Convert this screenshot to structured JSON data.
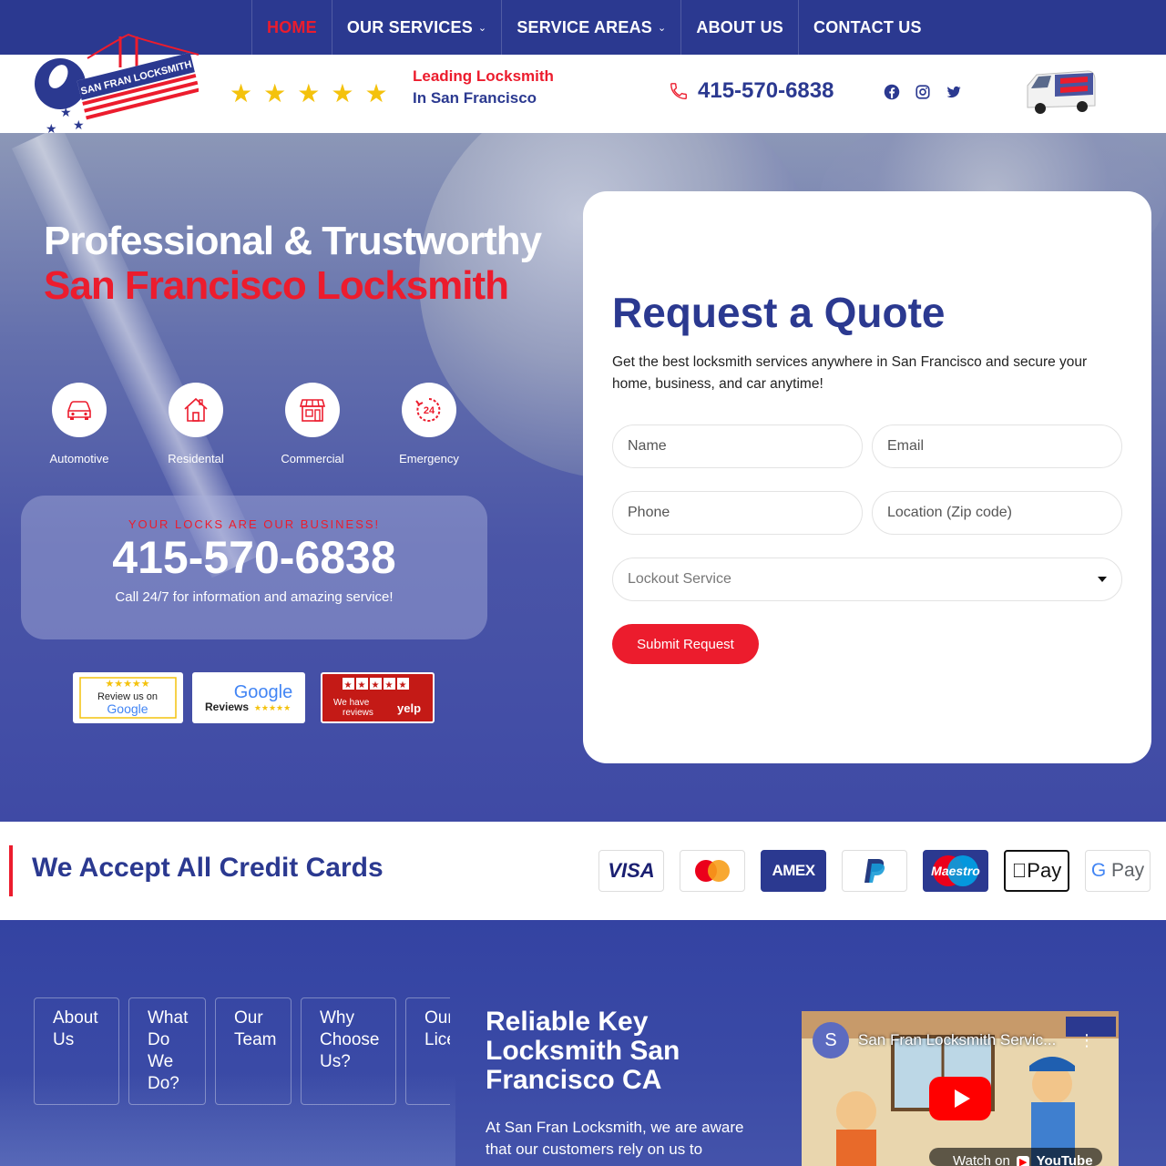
{
  "nav": {
    "items": [
      {
        "label": "HOME",
        "active": true,
        "dropdown": false
      },
      {
        "label": "OUR SERVICES",
        "active": false,
        "dropdown": true
      },
      {
        "label": "SERVICE AREAS",
        "active": false,
        "dropdown": true
      },
      {
        "label": "ABOUT US",
        "active": false,
        "dropdown": false
      },
      {
        "label": "CONTACT US",
        "active": false,
        "dropdown": false
      }
    ]
  },
  "header": {
    "logo_text": "SAN FRAN LOCKSMITH",
    "rating_stars": 5,
    "tagline_line1": "Leading Locksmith",
    "tagline_line2": "In San Francisco",
    "phone": "415-570-6838",
    "social": [
      "facebook-icon",
      "instagram-icon",
      "twitter-icon"
    ]
  },
  "hero": {
    "title_white": "Professional & Trustworthy ",
    "title_red": "San Francisco Locksmith",
    "services": [
      {
        "label": "Automotive",
        "icon": "car-icon"
      },
      {
        "label": "Residental",
        "icon": "house-icon"
      },
      {
        "label": "Commercial",
        "icon": "storefront-icon"
      },
      {
        "label": "Emergency",
        "icon": "24-hour-icon"
      }
    ],
    "callbox": {
      "kicker": "YOUR LOCKS ARE OUR BUSINESS!",
      "phone": "415-570-6838",
      "subtext": "Call 24/7 for information and amazing service!"
    },
    "badges": {
      "google_review_line1": "Review us on",
      "google_review_line2": "Google",
      "google_reviews_line1": "Google",
      "google_reviews_line2": "Reviews",
      "yelp_line1": "We have",
      "yelp_line2": "reviews",
      "yelp_brand": "yelp"
    }
  },
  "quote": {
    "title": "Request a Quote",
    "description": "Get the best locksmith services anywhere in San Francisco and secure your home, business, and car anytime!",
    "name_placeholder": "Name",
    "email_placeholder": "Email",
    "phone_placeholder": "Phone",
    "location_placeholder": "Location (Zip code)",
    "service_selected": "Lockout Service",
    "submit_label": "Submit Request"
  },
  "cards": {
    "heading": "We Accept All Credit Cards",
    "items": [
      "VISA",
      "Mastercard",
      "AMEX",
      "PayPal",
      "Maestro",
      "Apple Pay",
      "G Pay"
    ]
  },
  "bottom": {
    "tabs": [
      "About Us",
      "What Do We Do?",
      "Our Team",
      "Why Choose Us?",
      "Our Licenses"
    ],
    "heading": "Reliable Key Locksmith San Francisco CA",
    "paragraph": "At San Fran Locksmith, we are aware that our customers rely on us to",
    "video": {
      "channel_initial": "S",
      "title": "San Fran Locksmith Servic...",
      "watch_on": "Watch on",
      "platform": "YouTube"
    }
  },
  "colors": {
    "brand_blue": "#2b3990",
    "brand_red": "#ec1c2d",
    "star_yellow": "#f4c20d"
  }
}
